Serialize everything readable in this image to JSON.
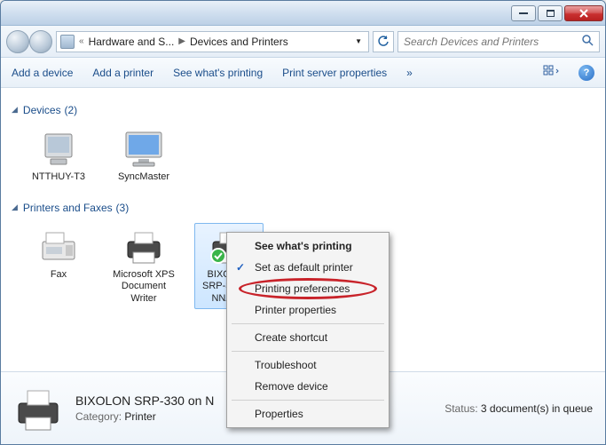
{
  "breadcrumb": {
    "item1": "Hardware and S...",
    "item2": "Devices and Printers"
  },
  "search": {
    "placeholder": "Search Devices and Printers"
  },
  "toolbar": {
    "add_device": "Add a device",
    "add_printer": "Add a printer",
    "see_printing": "See what's printing",
    "print_server": "Print server properties",
    "more": "»"
  },
  "sections": {
    "devices": {
      "label": "Devices",
      "count": "(2)"
    },
    "printers": {
      "label": "Printers and Faxes",
      "count": "(3)"
    }
  },
  "devices": [
    {
      "name": "NTTHUY-T3"
    },
    {
      "name": "SyncMaster"
    }
  ],
  "printers": [
    {
      "name": "Fax"
    },
    {
      "name": "Microsoft XPS Document Writer"
    },
    {
      "name": "BIXOLON SRP-330 on NNANH"
    }
  ],
  "context_menu": {
    "see_printing": "See what's printing",
    "set_default": "Set as default printer",
    "pref": "Printing preferences",
    "props": "Printer properties",
    "shortcut": "Create shortcut",
    "troubleshoot": "Troubleshoot",
    "remove": "Remove device",
    "properties": "Properties"
  },
  "details": {
    "name": "BIXOLON SRP-330 on N",
    "category_label": "Category:",
    "category_value": "Printer",
    "status_label": "Status:",
    "status_value": "3 document(s) in queue"
  }
}
